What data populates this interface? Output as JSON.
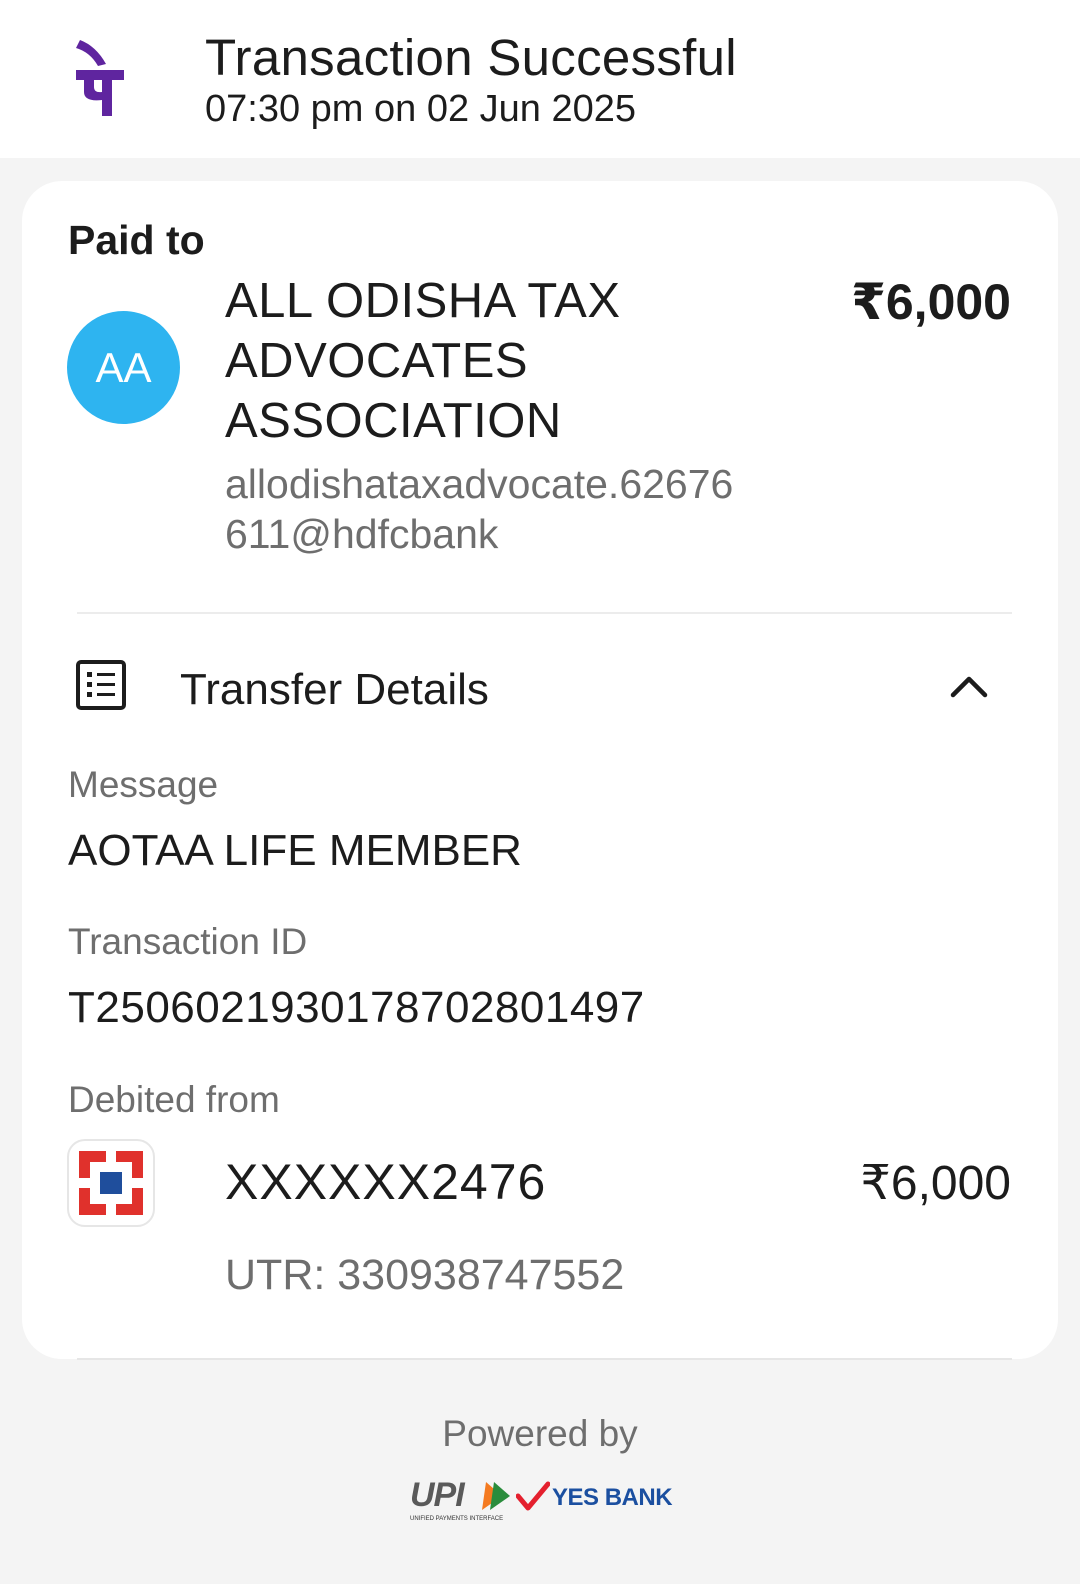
{
  "header": {
    "title": "Transaction Successful",
    "datetime": "07:30 pm on 02 Jun 2025",
    "logo_icon": "phonepe-logo-icon",
    "brand_color": "#5f259f"
  },
  "payee": {
    "section_label": "Paid to",
    "avatar_initials": "AA",
    "avatar_color": "#2eb4f0",
    "name": "ALL ODISHA TAX ADVOCATES ASSOCIATION",
    "vpa": "allodishataxadvocate.62676611@hdfcbank",
    "amount": "₹6,000"
  },
  "transfer_details": {
    "label": "Transfer Details",
    "icon": "receipt-list-icon",
    "toggle_icon": "chevron-up-icon",
    "message_label": "Message",
    "message_value": "AOTAA LIFE MEMBER",
    "txn_id_label": "Transaction ID",
    "txn_id_value": "T2506021930178702801497",
    "debited_label": "Debited from",
    "bank_icon": "hdfc-bank-logo-icon",
    "account": "XXXXXX2476",
    "debit_amount": "₹6,000",
    "utr": "UTR: 330938747552"
  },
  "footer": {
    "powered_by": "Powered by",
    "partner_logos": [
      "UPI",
      "YES BANK"
    ]
  }
}
